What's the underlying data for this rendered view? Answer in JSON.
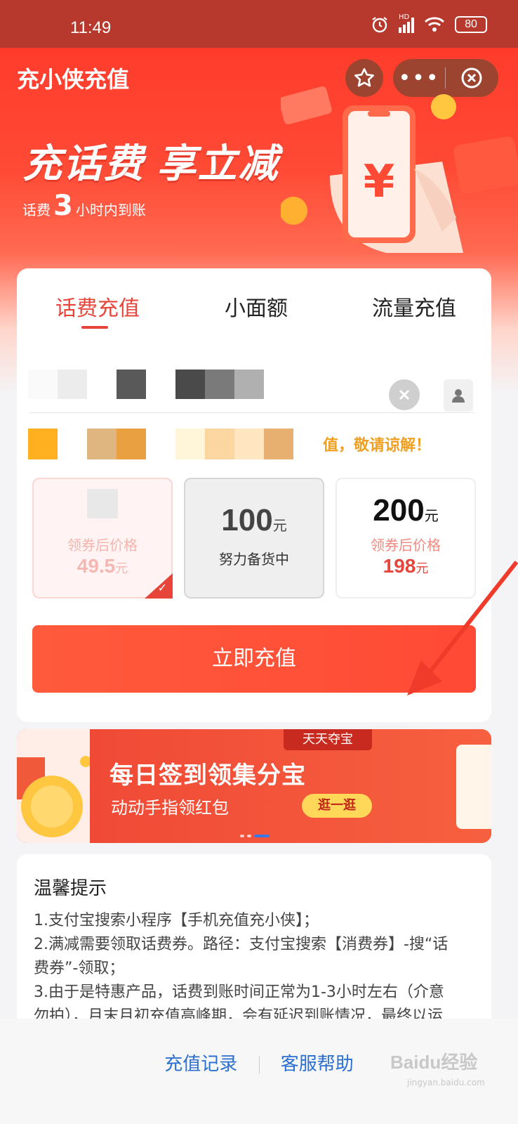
{
  "status_bar": {
    "time": "11:49",
    "battery": "80",
    "signal_label": "HD"
  },
  "header": {
    "title": "充小侠充值"
  },
  "hero": {
    "slogan": "充话费 享立减",
    "sub_prefix": "话费",
    "sub_number": "3",
    "sub_suffix": "小时内到账"
  },
  "tabs": [
    {
      "label": "话费充值",
      "active": true
    },
    {
      "label": "小面额",
      "active": false
    },
    {
      "label": "流量充值",
      "active": false
    }
  ],
  "notice": {
    "text": "值，敬请谅解！"
  },
  "amounts": [
    {
      "value": "",
      "unit": "元",
      "label": "领券后价格",
      "price": "49.5",
      "price_unit": "元",
      "state": "selected"
    },
    {
      "value": "100",
      "unit": "元",
      "label": "努力备货中",
      "price": "",
      "price_unit": "",
      "state": "disabled"
    },
    {
      "value": "200",
      "unit": "元",
      "label": "领券后价格",
      "price": "198",
      "price_unit": "元",
      "state": "normal"
    }
  ],
  "recharge_button": "立即充值",
  "banner": {
    "tag": "天天夺宝",
    "title": "每日签到领集分宝",
    "subtitle": "动动手指领红包",
    "button": "逛一逛"
  },
  "tips": {
    "title": "温馨提示",
    "lines": [
      "1.支付宝搜索小程序【手机充值充小侠】；",
      "2.满减需要领取话费券。路径：支付宝搜索【消费券】-搜“话",
      "费券”-领取；",
      "3.由于是特惠产品，话费到账时间正常为1-3小时左右（介意",
      "勿拍），月末月初充值高峰期，会有延迟到账情况，最终以运"
    ]
  },
  "bottom": {
    "records": "充值记录",
    "help": "客服帮助"
  },
  "watermark": {
    "brand": "Baidu经验",
    "url": "jingyan.baidu.com"
  },
  "colors": {
    "accent": "#e8453a",
    "link": "#2b6fd0",
    "notice": "#f0a020"
  }
}
